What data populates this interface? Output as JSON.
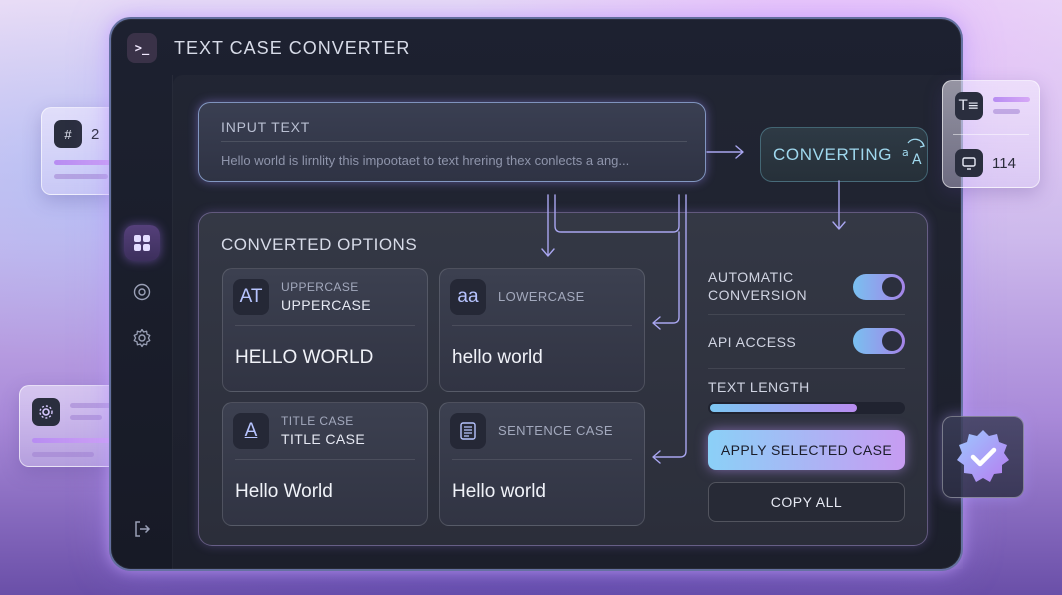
{
  "app": {
    "title": "TEXT CASE CONVERTER",
    "icon": "terminal-icon"
  },
  "sidebar": {
    "items": [
      {
        "name": "dashboard-icon",
        "active": true
      },
      {
        "name": "target-icon",
        "active": false
      },
      {
        "name": "gear-icon",
        "active": false
      },
      {
        "name": "logout-icon",
        "active": false
      }
    ]
  },
  "input": {
    "label": "INPUT TEXT",
    "value": "Hello world is lirnlity this impootaet to text hrering thex conlects a ang..."
  },
  "status": {
    "label": "CONVERTING",
    "icon": "translate-icon"
  },
  "options": {
    "title": "CONVERTED OPTIONS",
    "cards": [
      {
        "icon_text": "AT",
        "sub": "UPPERCASE",
        "main": "UPPERCASE",
        "result": "HELLO WORLD"
      },
      {
        "icon_text": "aa",
        "sub": "LOWERCASE",
        "main": "",
        "result": "hello world"
      },
      {
        "icon_text": "A",
        "sub": "TITLE CASE",
        "main": "TITLE CASE",
        "result": "Hello World"
      },
      {
        "icon_text": "",
        "sub": "SENTENCE CASE",
        "main": "",
        "result": "Hello world"
      }
    ]
  },
  "settings": {
    "auto_line1": "AUTOMATIC",
    "auto_line2": "CONVERSION",
    "auto_on": true,
    "api_label": "API ACCESS",
    "api_on": true,
    "length_label": "TEXT LENGTH",
    "length_fraction": 0.76,
    "apply_label": "APPLY SELECTED CASE",
    "copy_label": "COPY ALL"
  },
  "floating": {
    "hash_count": "2",
    "stats_count": "114"
  },
  "colors": {
    "accent_start": "#8bd0f7",
    "accent_end": "#c79cf2",
    "window_bg": "#1d2130",
    "glow": "#b48cff"
  }
}
